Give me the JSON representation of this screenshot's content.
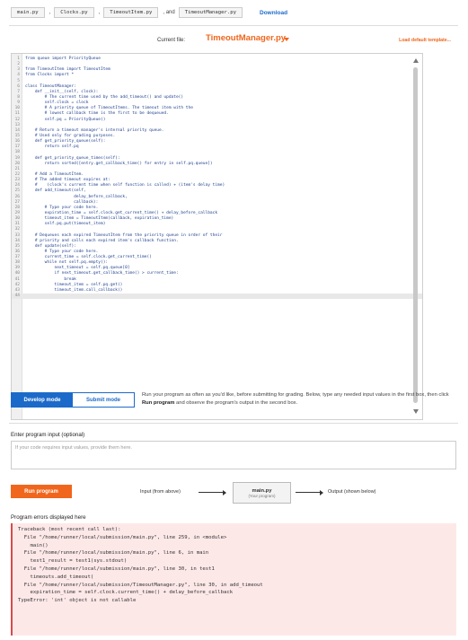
{
  "files": {
    "tabs": [
      "main.py",
      "Clocks.py",
      "TimeoutItem.py",
      "TimeoutManager.py"
    ],
    "sep1": ",",
    "sep2": ",",
    "sep3": ", and",
    "download": "Download"
  },
  "current_file": {
    "label": "Current file:",
    "name": "TimeoutManager.py",
    "load_template": "Load default template..."
  },
  "editor": {
    "lines": [
      "from queue import PriorityQueue",
      "",
      "from TimeoutItem import TimeoutItem",
      "from Clocks import *",
      "",
      "class TimeoutManager:",
      "    def __init__(self, clock):",
      "        # The current time used by the add_timeout() and update()",
      "        self.clock = clock",
      "        # A priority queue of TimeoutItems. The timeout item with the",
      "        # lowest callback time is the first to be dequeued.",
      "        self.pq = PriorityQueue()",
      "",
      "    # Return a timeout manager's internal priority queue.",
      "    # Used only for grading purposes.",
      "    def get_priority_queue(self):",
      "        return self.pq",
      "",
      "    def get_priority_queue_times(self):",
      "        return sorted([entry.get_callback_time() for entry in self.pq.queue])",
      "",
      "    # Add a TimeoutItem.",
      "    # The added timeout expires at:",
      "    #    (clock's current time when self function is called) + (item's delay time)",
      "    def add_timeout(self,",
      "                    delay_before_callback,",
      "                    callback):",
      "        # Type your code here.",
      "        expiration_time = self.clock.get_current_time() + delay_before_callback",
      "        timeout_item = TimeoutItem(callback, expiration_time)",
      "        self.pq.put(timeout_item)",
      "",
      "    # Dequeues each expired TimeoutItem from the priority queue in order of their",
      "    # priority and calls each expired item's callback function.",
      "    def update(self):",
      "        # Type your code here.",
      "        current_time = self.clock.get_current_time()",
      "        while not self.pq.empty():",
      "            next_timeout = self.pq.queue[0]",
      "            if next_timeout.get_callback_time() > current_time:",
      "                break",
      "            timeout_item = self.pq.get()",
      "            timeout_item.call_callback()",
      ""
    ]
  },
  "modes": {
    "develop": "Develop mode",
    "submit": "Submit mode",
    "desc_pre": "Run your program as often as you'd like, before submitting for grading. Below, type any needed input values in the first box, then click ",
    "desc_bold": "Run program",
    "desc_post": " and observe the program's output in the second box."
  },
  "input": {
    "label": "Enter program input (optional)",
    "placeholder": "If your code requires input values, provide them here."
  },
  "run": {
    "button": "Run program",
    "input_from": "Input (from above)",
    "main_title": "main.py",
    "main_sub": "(Your program)",
    "output": "Output (shown below)"
  },
  "errors": {
    "label": "Program errors displayed here",
    "lines": [
      "Traceback (most recent call last):",
      "  File \"/home/runner/local/submission/main.py\", line 259, in <module>",
      "    main()",
      "  File \"/home/runner/local/submission/main.py\", line 6, in main",
      "    test1_result = test1(sys.stdout)",
      "  File \"/home/runner/local/submission/main.py\", line 30, in test1",
      "    timeouts.add_timeout(",
      "  File \"/home/runner/local/submission/TimeoutManager.py\", line 30, in add_timeout",
      "    expiration_time = self.clock.current_time() + delay_before_callback",
      "TypeError: 'int' object is not callable"
    ]
  }
}
